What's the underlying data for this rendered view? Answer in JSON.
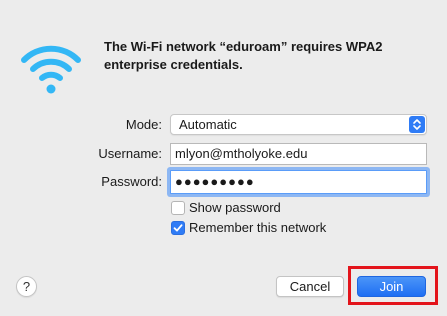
{
  "dialog": {
    "message": "The Wi-Fi network “eduroam” requires WPA2 enterprise credentials.",
    "icon": "wifi-icon"
  },
  "form": {
    "mode_label": "Mode:",
    "mode_value": "Automatic",
    "username_label": "Username:",
    "username_value": "mlyon@mtholyoke.edu",
    "password_label": "Password:",
    "password_value": "●●●●●●●●●"
  },
  "options": {
    "show_password_label": "Show password",
    "show_password_checked": false,
    "remember_label": "Remember this network",
    "remember_checked": true
  },
  "buttons": {
    "help_label": "?",
    "cancel_label": "Cancel",
    "join_label": "Join"
  },
  "colors": {
    "accent": "#2f7cf6",
    "wifi_icon": "#33b7f5",
    "highlight": "#e3141b"
  }
}
